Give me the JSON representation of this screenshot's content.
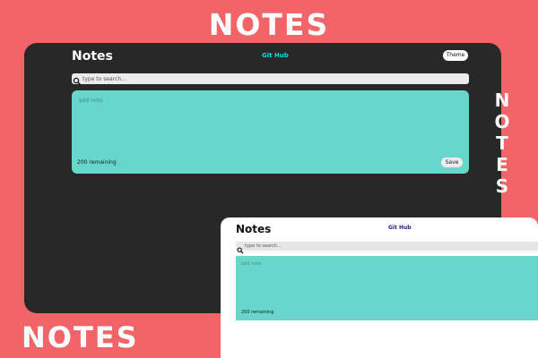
{
  "promo": {
    "top_title": "NOTES",
    "bottom_title": "NOTES",
    "vertical_title": "NOTES"
  },
  "dark_app": {
    "title": "Notes",
    "github_link": "Git Hub",
    "theme_button": "Theme",
    "search_placeholder": "type to search...",
    "note_placeholder": "add note",
    "remaining": "200 remaining",
    "save_button": "Save"
  },
  "light_app": {
    "title": "Notes",
    "github_link": "Git Hub",
    "search_placeholder": "type to search...",
    "note_placeholder": "add note",
    "remaining": "200 remaining"
  },
  "colors": {
    "background": "#f36468",
    "dark_window": "#282828",
    "note_card": "#67d7cc",
    "dark_link": "#00e0e0",
    "light_link": "#2b1b7a"
  },
  "icons": {
    "search": "search-icon"
  }
}
